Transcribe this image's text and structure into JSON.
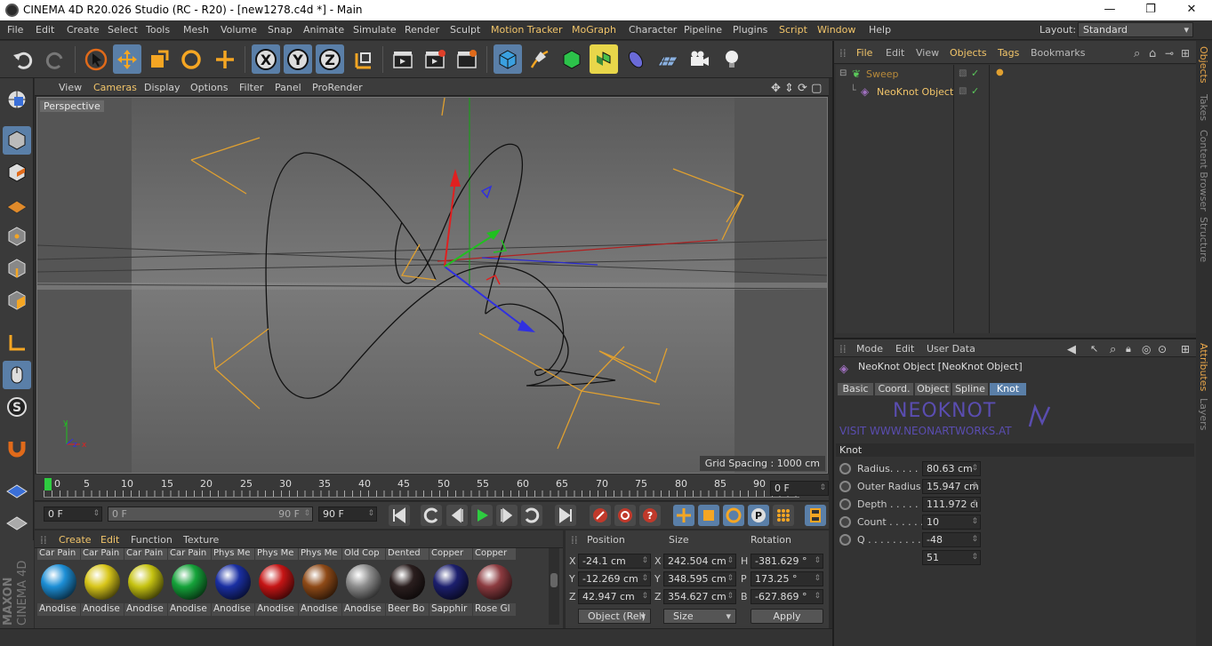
{
  "window": {
    "title": "CINEMA 4D R20.026 Studio (RC - R20) - [new1278.c4d *] - Main",
    "minimize": "—",
    "maximize": "❐",
    "close": "✕"
  },
  "menubar": {
    "items": [
      "File",
      "Edit",
      "Create",
      "Select",
      "Tools",
      "Mesh",
      "Volume",
      "Snap",
      "Animate",
      "Simulate",
      "Render",
      "Sculpt",
      "Motion Tracker",
      "MoGraph",
      "Character",
      "Pipeline",
      "Plugins",
      "Script",
      "Window",
      "Help"
    ],
    "layout_label": "Layout:",
    "layout_value": "Standard"
  },
  "viewport": {
    "menu": [
      "View",
      "Cameras",
      "Display",
      "Options",
      "Filter",
      "Panel",
      "ProRender"
    ],
    "label": "Perspective",
    "grid_spacing": "Grid Spacing : 1000 cm"
  },
  "timeline": {
    "ticks": [
      "0",
      "5",
      "10",
      "15",
      "20",
      "25",
      "30",
      "35",
      "40",
      "45",
      "50",
      "55",
      "60",
      "65",
      "70",
      "75",
      "80",
      "85",
      "90"
    ],
    "current_frame": "0 F",
    "start": "0 F",
    "range_start": "0 F",
    "range_end": "90 F",
    "end": "90 F"
  },
  "materials": {
    "menu": [
      "Create",
      "Edit",
      "Function",
      "Texture"
    ],
    "items": [
      {
        "top": "Car Pain",
        "label": "Anodise",
        "color": "#1d8fd6"
      },
      {
        "top": "Car Pain",
        "label": "Anodise",
        "color": "#d8c61a"
      },
      {
        "top": "Car Pain",
        "label": "Anodise",
        "color": "#c6c312"
      },
      {
        "top": "Car Pain",
        "label": "Anodise",
        "color": "#15a33a"
      },
      {
        "top": "Phys Me",
        "label": "Anodise",
        "color": "#1a2fa3"
      },
      {
        "top": "Phys Me",
        "label": "Anodise",
        "color": "#c61515"
      },
      {
        "top": "Phys Me",
        "label": "Anodise",
        "color": "#8f4a17"
      },
      {
        "top": "Old Cop",
        "label": "Anodise",
        "color": "#8d8d8d"
      },
      {
        "top": "Dented",
        "label": "Beer Bo",
        "color": "#2a1e1e"
      },
      {
        "top": "Copper",
        "label": "Sapphir",
        "color": "#1c1f6e"
      },
      {
        "top": "Copper",
        "label": "Rose Gl",
        "color": "#8c3b40"
      }
    ]
  },
  "coordinates": {
    "headers": [
      "Position",
      "Size",
      "Rotation"
    ],
    "rows": [
      {
        "axis": "X",
        "pos": "-24.1 cm",
        "size_axis": "X",
        "size": "242.504 cm",
        "rot_axis": "H",
        "rot": "-381.629 °"
      },
      {
        "axis": "Y",
        "pos": "-12.269 cm",
        "size_axis": "Y",
        "size": "348.595 cm",
        "rot_axis": "P",
        "rot": "173.25 °"
      },
      {
        "axis": "Z",
        "pos": "42.947 cm",
        "size_axis": "Z",
        "size": "354.627 cm",
        "rot_axis": "B",
        "rot": "-627.869 °"
      }
    ],
    "mode": "Object (Rel)",
    "size_mode": "Size",
    "apply": "Apply"
  },
  "objects": {
    "menu": [
      "File",
      "Edit",
      "View",
      "Objects",
      "Tags",
      "Bookmarks"
    ],
    "items": [
      "Sweep",
      "NeoKnot Object"
    ]
  },
  "sidetabs": [
    "Objects",
    "Takes",
    "Content Browser",
    "Structure",
    "Attributes",
    "Layers"
  ],
  "attributes": {
    "menu": [
      "Mode",
      "Edit",
      "User Data"
    ],
    "title": "NeoKnot Object [NeoKnot Object]",
    "tabs": [
      "Basic",
      "Coord.",
      "Object",
      "Spline",
      "Knot"
    ],
    "banner_title": "NEOKNOT",
    "banner_url": "VISIT WWW.NEONARTWORKS.AT",
    "section": "Knot",
    "params": [
      {
        "label": "Radius. . . . . .",
        "value": "80.63 cm"
      },
      {
        "label": "Outer Radius",
        "value": "15.947 cm"
      },
      {
        "label": "Depth . . . . . .",
        "value": "111.972 cı"
      },
      {
        "label": "Count . . . . . .",
        "value": "10"
      },
      {
        "label": "Q . . . . . . . . . .",
        "value": "-48"
      },
      {
        "label": "",
        "value": "51"
      }
    ]
  },
  "brand": {
    "line1": "MAXON",
    "line2": "CINEMA 4D"
  },
  "colors": {
    "accent": "#f2c56a",
    "active_blue": "#5a7fa8",
    "orange_lines": "#e0a030"
  }
}
